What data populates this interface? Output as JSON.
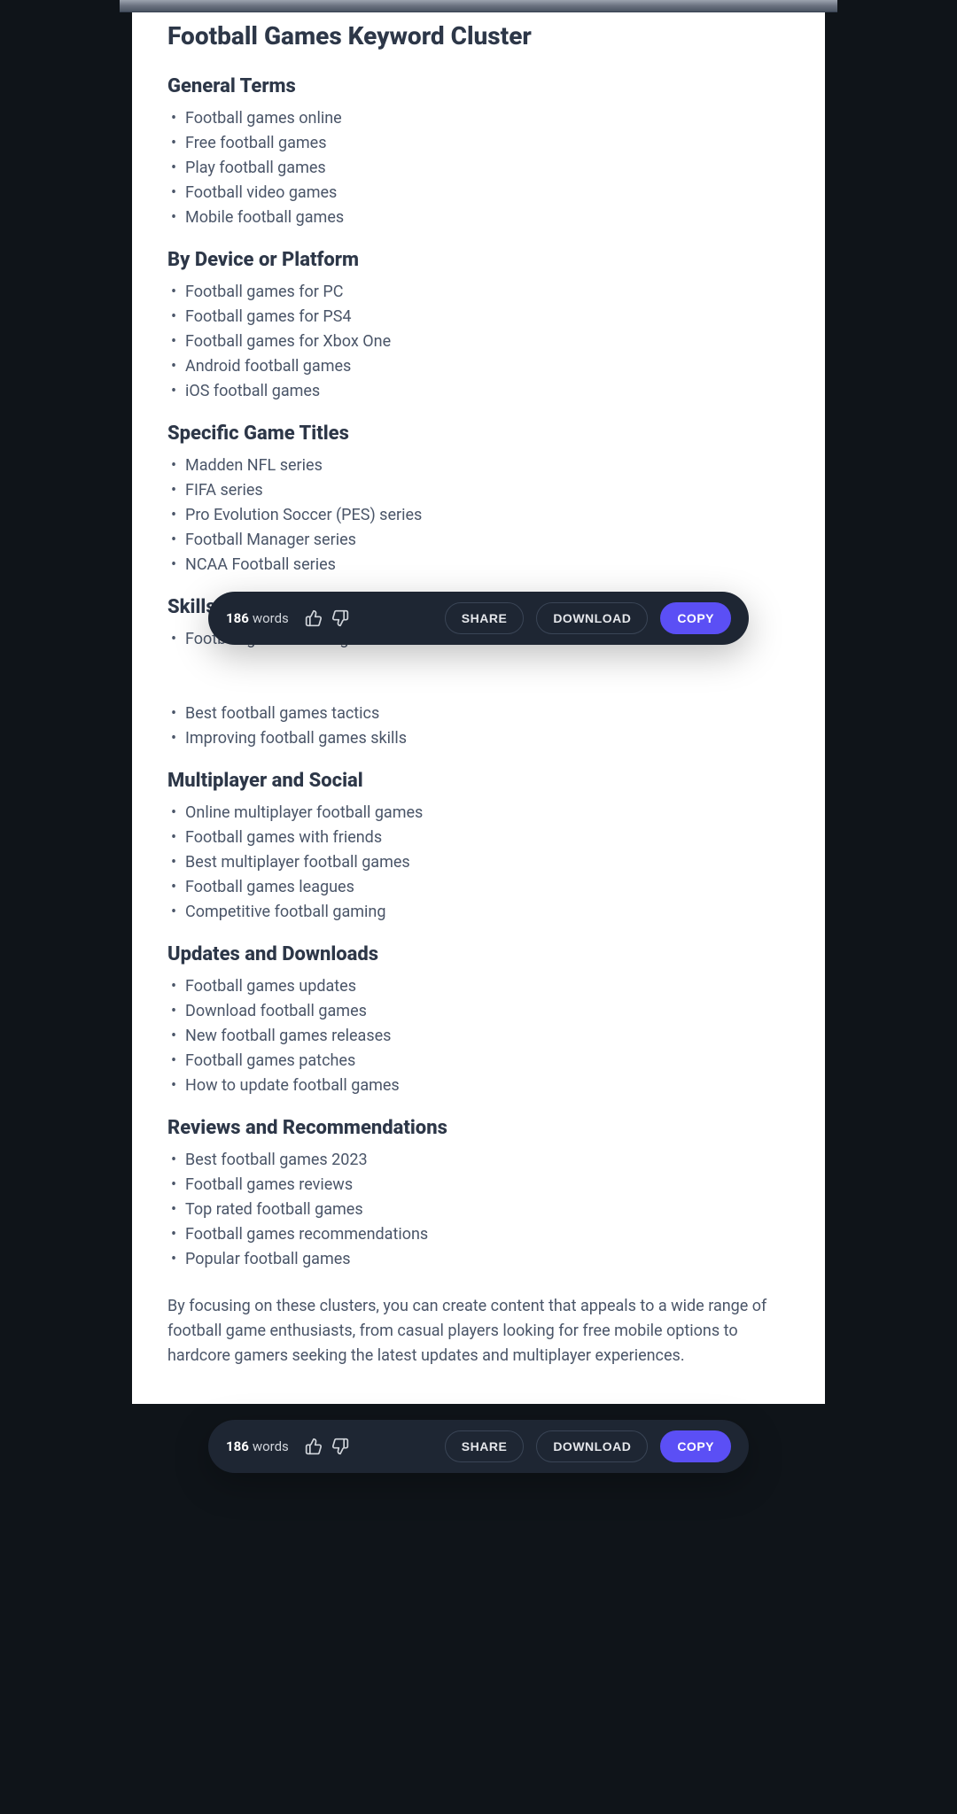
{
  "title": "Football Games Keyword Cluster",
  "sections": [
    {
      "heading": "General Terms",
      "items": [
        "Football games online",
        "Free football games",
        "Play football games",
        "Football video games",
        "Mobile football games"
      ]
    },
    {
      "heading": "By Device or Platform",
      "items": [
        "Football games for PC",
        "Football games for PS4",
        "Football games for Xbox One",
        "Android football games",
        "iOS football games"
      ]
    },
    {
      "heading": "Specific Game Titles",
      "items": [
        "Madden NFL series",
        "FIFA series",
        "Pro Evolution Soccer (PES) series",
        "Football Manager series",
        "NCAA Football series"
      ]
    },
    {
      "heading": "Skills and Tips",
      "items": [
        "Football games strategies",
        "",
        "",
        "Best football games tactics",
        "Improving football games skills"
      ]
    },
    {
      "heading": "Multiplayer and Social",
      "items": [
        "Online multiplayer football games",
        "Football games with friends",
        "Best multiplayer football games",
        "Football games leagues",
        "Competitive football gaming"
      ]
    },
    {
      "heading": "Updates and Downloads",
      "items": [
        "Football games updates",
        "Download football games",
        "New football games releases",
        "Football games patches",
        "How to update football games"
      ]
    },
    {
      "heading": "Reviews and Recommendations",
      "items": [
        "Best football games 2023",
        "Football games reviews",
        "Top rated football games",
        "Football games recommendations",
        "Popular football games"
      ]
    }
  ],
  "closing": "By focusing on these clusters, you can create content that appeals to a wide range of football game enthusiasts, from casual players looking for free mobile options to hardcore gamers seeking the latest updates and multiplayer experiences.",
  "toolbar": {
    "count": "186",
    "words_label": "words",
    "share": "SHARE",
    "download": "DOWNLOAD",
    "copy": "COPY"
  }
}
